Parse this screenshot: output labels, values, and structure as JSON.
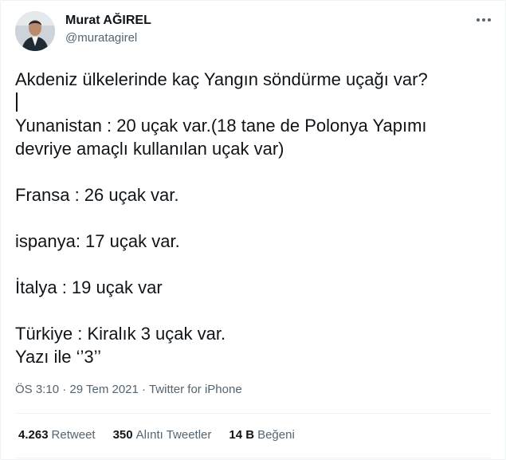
{
  "tweet": {
    "author": {
      "name": "Murat AĞIREL",
      "handle": "@muratagirel",
      "avatar": "profile-photo"
    },
    "more_icon": "more-horizontal-icon",
    "text_lines": [
      "Akdeniz ülkelerinde kaç Yangın söndürme uçağı var?",
      "Yunanistan : 20 uçak var.(18 tane de Polonya Yapımı",
      "devriye amaçlı kullanılan uçak var)",
      "Fransa : 26 uçak var.",
      "ispanya: 17 uçak var.",
      "İtalya : 19 uçak var",
      "Türkiye : Kiralık 3 uçak var.",
      "Yazı ile ‘’3’’"
    ],
    "time": "ÖS 3:10",
    "date": "29 Tem 2021",
    "separator": "·",
    "source": "Twitter for iPhone",
    "stats": {
      "retweets_count": "4.263",
      "retweets_label": "Retweet",
      "quotes_count": "350",
      "quotes_label": "Alıntı Tweetler",
      "likes_count": "14 B",
      "likes_label": "Beğeni"
    }
  }
}
